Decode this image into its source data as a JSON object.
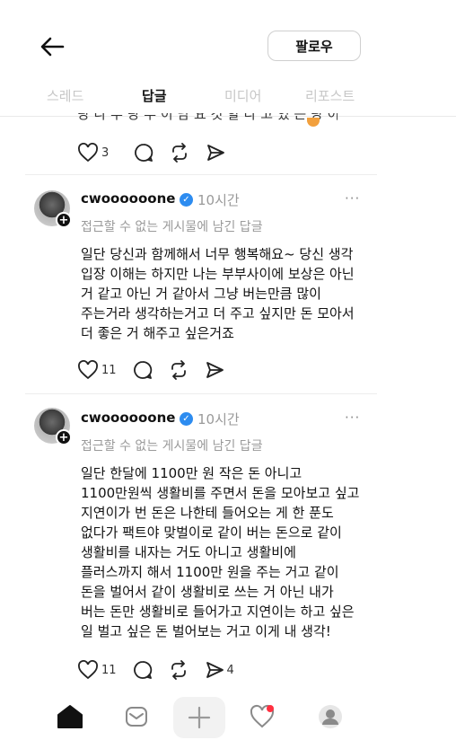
{
  "header": {
    "follow_label": "팔로우"
  },
  "tabs": [
    {
      "label": "스레드"
    },
    {
      "label": "답글"
    },
    {
      "label": "미디어"
    },
    {
      "label": "리포스트"
    }
  ],
  "prev_post": {
    "cut_text": "당 나 부 당 부 이 남 요 것 할 다 고 있 는 당 이",
    "likes": "3"
  },
  "posts": [
    {
      "username": "cwoooooone",
      "time": "10시간",
      "more": "···",
      "subtitle": "접근할 수 없는 게시물에 남긴 답글",
      "text": "일단 당신과 함께해서 너무 행복해요~  당신 생각\n입장 이해는 하지만 나는 부부사이에 보상은 아닌\n거 같고 아닌 거 같아서 그냥 버는만큼  많이\n주는거라 생각하는거고 더 주고 싶지만 돈 모아서\n더 좋은 거 해주고 싶은거죠",
      "likes": "11",
      "shares": ""
    },
    {
      "username": "cwoooooone",
      "time": "10시간",
      "more": "···",
      "subtitle": "접근할 수 없는 게시물에 남긴 답글",
      "text": "일단 한달에 1100만 원 작은 돈 아니고\n1100만원씩 생활비를 주면서 돈을 모아보고 싶고\n지연이가 번 돈은 나한테 들어오는 게 한 푼도\n없다가 팩트야 맞벌이로 같이 버는 돈으로 같이\n생활비를 내자는 거도 아니고 생활비에\n플러스까지 해서 1100만 원을 주는 거고 같이\n돈을 벌어서 같이 생활비로 쓰는 거 아닌 내가\n버는 돈만 생활비로 들어가고 지연이는 하고 싶은\n일 벌고 싶은 돈 벌어보는 거고 이게 내 생각!",
      "likes": "11",
      "shares": "4"
    }
  ],
  "colors": {
    "verified": "#2d8cf0",
    "notification_dot": "#ff3040",
    "muted": "#9a9a9a"
  },
  "icons": [
    "back-arrow-icon",
    "heart-icon",
    "comment-icon",
    "repost-icon",
    "share-icon",
    "home-icon",
    "search-icon",
    "plus-icon",
    "activity-heart-icon",
    "profile-icon"
  ]
}
